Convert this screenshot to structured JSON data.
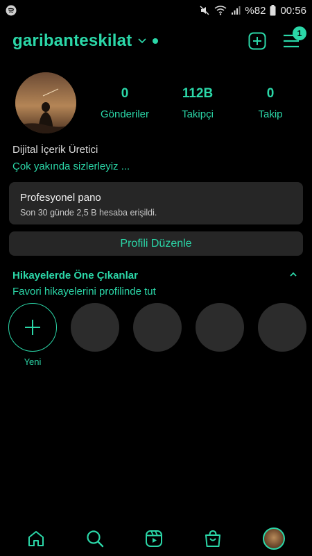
{
  "status_bar": {
    "battery_percent": "%82",
    "time": "00:56"
  },
  "header": {
    "username": "garibanteskilat",
    "notification_count": "1"
  },
  "profile": {
    "stats": [
      {
        "value": "0",
        "label": "Gönderiler"
      },
      {
        "value": "112B",
        "label": "Takipçi"
      },
      {
        "value": "0",
        "label": "Takip"
      }
    ],
    "bio_role": "Dijital İçerik Üretici",
    "bio_text": "Çok yakında sizlerleyiz ..."
  },
  "dashboard": {
    "title": "Profesyonel pano",
    "subtitle": "Son 30 günde 2,5 B hesaba erişildi."
  },
  "edit_profile": {
    "label": "Profili Düzenle"
  },
  "highlights": {
    "title": "Hikayelerde Öne Çıkanlar",
    "subtitle": "Favori hikayelerini profilinde tut",
    "new_label": "Yeni"
  },
  "colors": {
    "accent": "#2bd7a8",
    "background": "#000000",
    "card": "#262626"
  }
}
